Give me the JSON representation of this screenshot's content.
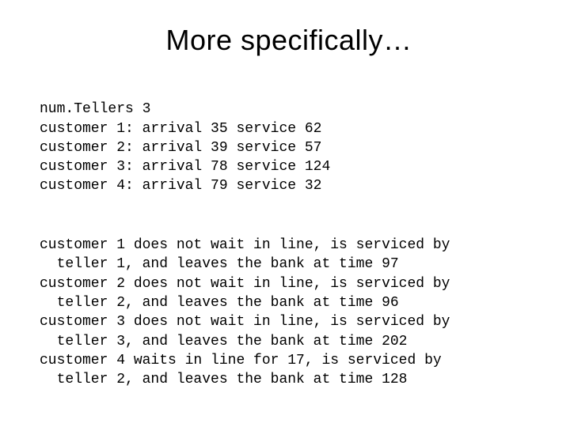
{
  "title": "More specifically…",
  "input_lines": [
    "num.Tellers 3",
    "customer 1: arrival 35 service 62",
    "customer 2: arrival 39 service 57",
    "customer 3: arrival 78 service 124",
    "customer 4: arrival 79 service 32"
  ],
  "output_lines": [
    "customer 1 does not wait in line, is serviced by",
    "  teller 1, and leaves the bank at time 97",
    "customer 2 does not wait in line, is serviced by",
    "  teller 2, and leaves the bank at time 96",
    "customer 3 does not wait in line, is serviced by",
    "  teller 3, and leaves the bank at time 202",
    "customer 4 waits in line for 17, is serviced by",
    "  teller 2, and leaves the bank at time 128"
  ]
}
